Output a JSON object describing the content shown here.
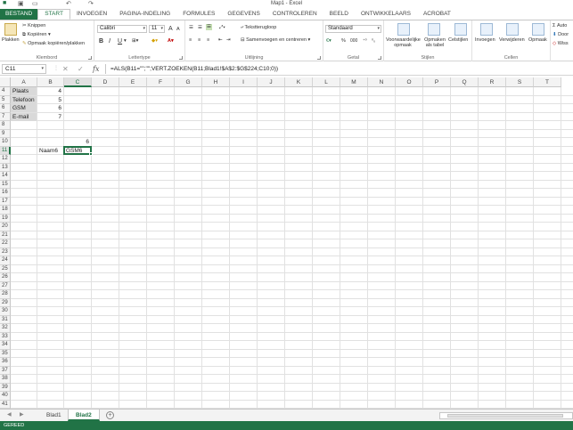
{
  "window": {
    "title": "Map1 - Excel"
  },
  "tabs": [
    "BESTAND",
    "START",
    "INVOEGEN",
    "PAGINA-INDELING",
    "FORMULES",
    "GEGEVENS",
    "CONTROLEREN",
    "BEELD",
    "ONTWIKKELAARS",
    "ACROBAT"
  ],
  "ribbon": {
    "clipboard": {
      "label": "Klembord",
      "paste": "Plakken",
      "cut": "Knippen",
      "copy": "Kopiëren",
      "format_painter": "Opmaak kopiëren/plakken"
    },
    "font": {
      "label": "Lettertype",
      "name": "Calibri",
      "size": "11",
      "bold": "B",
      "italic": "I",
      "underline": "U",
      "grow": "A",
      "shrink": "A"
    },
    "alignment": {
      "label": "Uitlijning",
      "wrap": "Tekstterugloop",
      "merge": "Samenvoegen en centreren"
    },
    "number": {
      "label": "Getal",
      "format": "Standaard",
      "percent": "%",
      "comma": "000"
    },
    "styles": {
      "label": "Stijlen",
      "conditional": "Voorwaardelijke opmaak",
      "as_table": "Opmaken als tabel",
      "cell_styles": "Celstijlen"
    },
    "cells": {
      "label": "Cellen",
      "insert": "Invoegen",
      "delete": "Verwijderen",
      "format": "Opmaak"
    },
    "editing": {
      "auto": "Auto",
      "fill": "Door",
      "clear": "Wiss"
    }
  },
  "formula_bar": {
    "name_box": "C11",
    "cancel": "✕",
    "enter": "✓",
    "fx": "fx",
    "formula": "=ALS(B11=\"\";\"\";VERT.ZOEKEN(B11;Blad1!$A$2:$G$224;C10;0))"
  },
  "grid": {
    "columns": [
      "A",
      "B",
      "C",
      "D",
      "E",
      "F",
      "G",
      "H",
      "I",
      "J",
      "K",
      "L",
      "M",
      "N",
      "O",
      "P",
      "Q",
      "R",
      "S",
      "T"
    ],
    "rows": [
      "4",
      "5",
      "6",
      "7",
      "8",
      "9",
      "10",
      "11",
      "12",
      "13",
      "14",
      "15",
      "16",
      "17",
      "18",
      "19",
      "20",
      "21",
      "22",
      "23",
      "24",
      "25",
      "26",
      "27",
      "28",
      "29",
      "30",
      "31",
      "32",
      "33",
      "34",
      "35",
      "36",
      "37",
      "38",
      "39",
      "40",
      "41",
      "42"
    ],
    "cells": {
      "A4": "Plaats",
      "B4": "4",
      "A5": "Telefoon",
      "B5": "5",
      "A6": "GSM",
      "B6": "6",
      "A7": "E-mail",
      "B7": "7",
      "C10": "6",
      "B11": "Naam6",
      "C11": "GSM6"
    },
    "selected_cell": "C11",
    "selected_column": "C",
    "selected_row": "11"
  },
  "sheets": {
    "tabs": [
      "Blad1",
      "Blad2"
    ],
    "active": "Blad2",
    "add": "+"
  },
  "status": {
    "text": "GEREED"
  },
  "colors": {
    "accent": "#217346",
    "shade": "#d9d9d9"
  }
}
